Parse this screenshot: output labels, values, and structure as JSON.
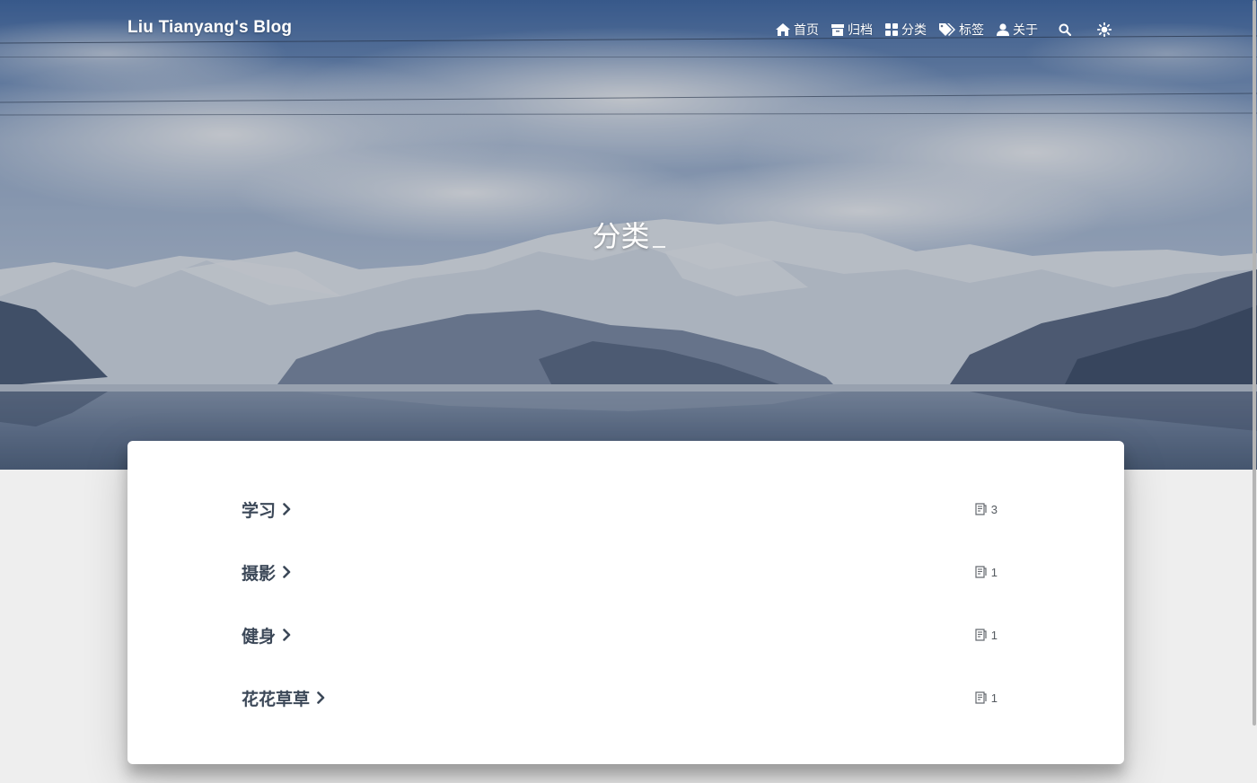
{
  "site": {
    "brand": "Liu Tianyang's Blog"
  },
  "nav": {
    "items": [
      {
        "label": "首页",
        "icon": "home-icon"
      },
      {
        "label": "归档",
        "icon": "archive-icon"
      },
      {
        "label": "分类",
        "icon": "categories-icon"
      },
      {
        "label": "标签",
        "icon": "tags-icon"
      },
      {
        "label": "关于",
        "icon": "user-icon"
      }
    ],
    "search_icon": "search-icon",
    "theme_icon": "sun-icon"
  },
  "hero": {
    "title": "分类"
  },
  "categories": [
    {
      "name": "学习",
      "count": "3"
    },
    {
      "name": "摄影",
      "count": "1"
    },
    {
      "name": "健身",
      "count": "1"
    },
    {
      "name": "花花草草",
      "count": "1"
    }
  ],
  "colors": {
    "text_dark": "#3c4858",
    "background": "#eeeeee",
    "card": "#ffffff"
  }
}
